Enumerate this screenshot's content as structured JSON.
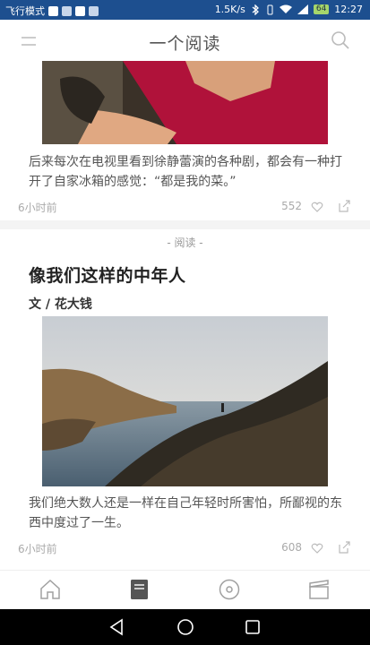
{
  "status_bar": {
    "mode": "飞行模式",
    "speed": "1.5K/s",
    "battery": "64",
    "time": "12:27"
  },
  "header": {
    "title": "一个阅读",
    "menu_icon": "menu-icon",
    "search_icon": "search-icon"
  },
  "feed": [
    {
      "excerpt": "后来每次在电视里看到徐静蕾演的各种剧，都会有一种打开了自家冰箱的感觉：“都是我的菜。”",
      "time": "6小时前",
      "count": "552"
    },
    {
      "category": "- 阅读 -",
      "title": "像我们这样的中年人",
      "author": "文 / 花大钱",
      "excerpt": "我们绝大数人还是一样在自己年轻时所害怕，所鄙视的东西中度过了一生。",
      "time": "6小时前",
      "count": "608"
    }
  ],
  "tabbar": {
    "items": [
      "home-icon",
      "reading-icon",
      "music-icon",
      "movie-icon"
    ],
    "active_color": "#555555",
    "inactive_color": "#a0a0a0"
  },
  "nav_bar": {
    "buttons": [
      "back-icon",
      "home-circle-icon",
      "recent-apps-icon"
    ]
  }
}
